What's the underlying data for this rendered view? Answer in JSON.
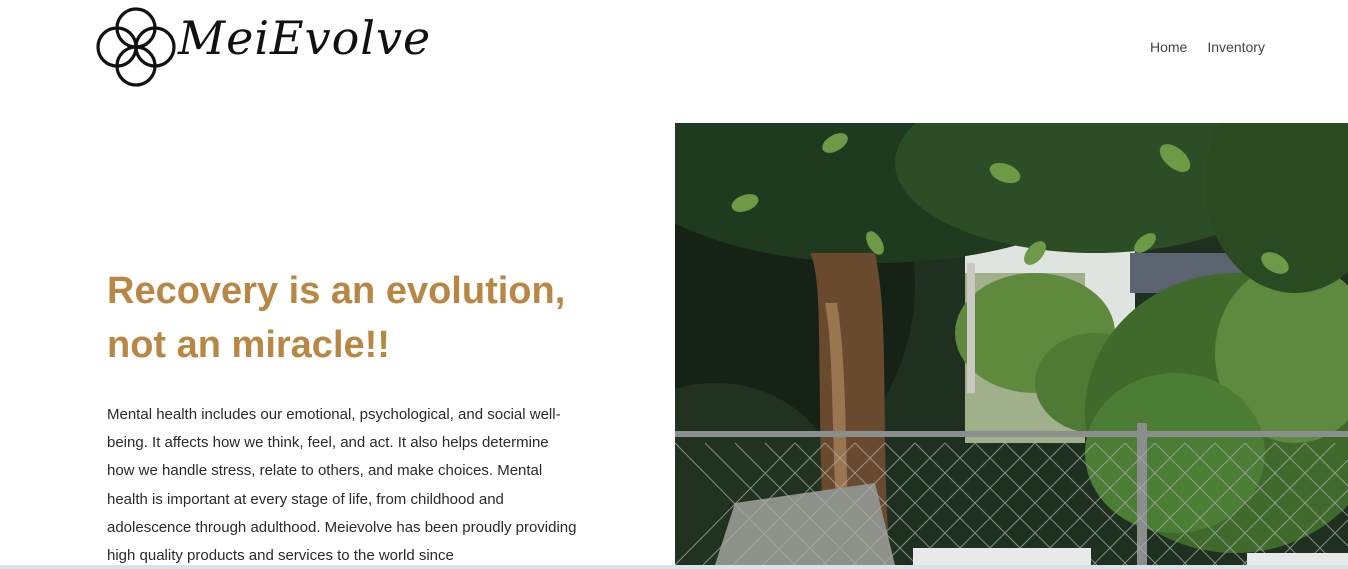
{
  "brand": {
    "name": "MeiEvolve"
  },
  "nav": {
    "items": [
      {
        "label": "Home"
      },
      {
        "label": "Inventory"
      }
    ]
  },
  "hero": {
    "headline": "Recovery is an evolution, not an miracle!!",
    "body": "Mental health includes our emotional, psychological, and social well-being. It affects how we think, feel, and act. It also helps determine how we handle stress, relate to others, and make choices. Mental health is important at every stage of life, from childhood and adolescence through adulthood. Meievolve has been proudly providing high quality products and services to the world since",
    "image": "tree-behind-chain-link-fence-photo"
  },
  "colors": {
    "headline": "#b98744",
    "body_text": "#2a2a2a",
    "nav_text": "#444444",
    "logo": "#111111",
    "bottom_strip": "#d6e4e8"
  }
}
